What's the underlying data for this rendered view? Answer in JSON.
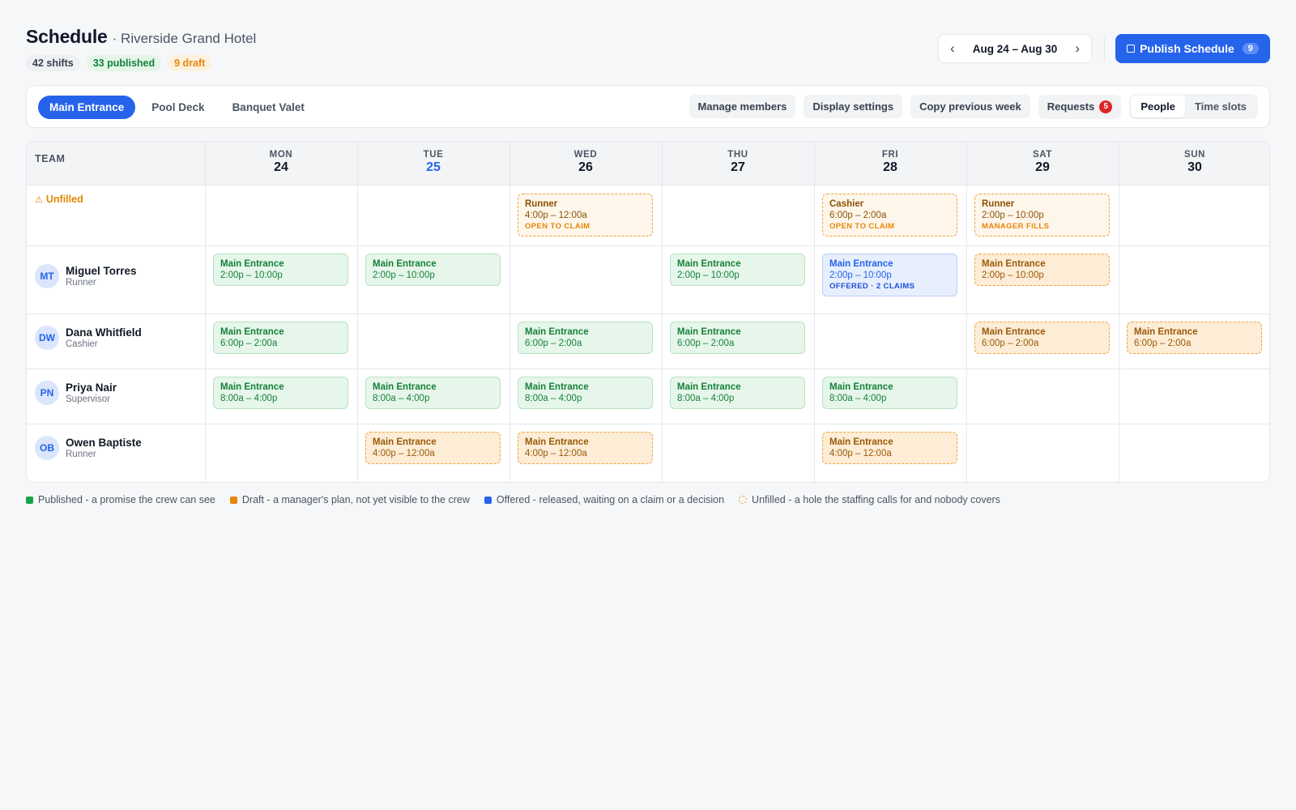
{
  "header": {
    "title": "Schedule",
    "subtitle": "· Riverside Grand Hotel",
    "stats": {
      "shifts": "42 shifts",
      "published": "33 published",
      "draft": "9 draft"
    },
    "week_range": "Aug 24 – Aug 30",
    "prev_arrow": "‹",
    "next_arrow": "›",
    "publish_label": "Publish Schedule",
    "publish_count": "9"
  },
  "toolbar": {
    "tabs": [
      {
        "label": "Main Entrance",
        "active": true
      },
      {
        "label": "Pool Deck",
        "active": false
      },
      {
        "label": "Banquet Valet",
        "active": false
      }
    ],
    "actions": {
      "manage_members": "Manage members",
      "display_settings": "Display settings",
      "copy_previous_week": "Copy previous week",
      "requests": "Requests",
      "requests_count": "5"
    },
    "view_toggle": {
      "people": "People",
      "time_slots": "Time slots",
      "active": "People"
    }
  },
  "grid": {
    "team_header": "TEAM",
    "days": [
      {
        "dow": "MON",
        "num": "24"
      },
      {
        "dow": "TUE",
        "num": "25",
        "today": true
      },
      {
        "dow": "WED",
        "num": "26"
      },
      {
        "dow": "THU",
        "num": "27"
      },
      {
        "dow": "FRI",
        "num": "28"
      },
      {
        "dow": "SAT",
        "num": "29"
      },
      {
        "dow": "SUN",
        "num": "30"
      }
    ],
    "unfilled_label": "Unfilled",
    "unfilled_shifts": [
      {
        "day": 2,
        "role": "Runner",
        "time": "4:00p – 12:00a",
        "note": "OPEN TO CLAIM"
      },
      {
        "day": 4,
        "role": "Cashier",
        "time": "6:00p – 2:00a",
        "note": "OPEN TO CLAIM"
      },
      {
        "day": 5,
        "role": "Runner",
        "time": "2:00p – 10:00p",
        "note": "MANAGER FILLS"
      }
    ],
    "people": [
      {
        "initials": "MT",
        "name": "Miguel Torres",
        "role": "Runner",
        "shifts": [
          {
            "day": 0,
            "state": "published",
            "name": "Main Entrance",
            "time": "2:00p – 10:00p"
          },
          {
            "day": 1,
            "state": "published",
            "name": "Main Entrance",
            "time": "2:00p – 10:00p"
          },
          {
            "day": 3,
            "state": "published",
            "name": "Main Entrance",
            "time": "2:00p – 10:00p"
          },
          {
            "day": 4,
            "state": "offered",
            "name": "Main Entrance",
            "time": "2:00p – 10:00p",
            "note": "OFFERED · 2 CLAIMS"
          },
          {
            "day": 5,
            "state": "draft",
            "name": "Main Entrance",
            "time": "2:00p – 10:00p"
          }
        ]
      },
      {
        "initials": "DW",
        "name": "Dana Whitfield",
        "role": "Cashier",
        "shifts": [
          {
            "day": 0,
            "state": "published",
            "name": "Main Entrance",
            "time": "6:00p – 2:00a"
          },
          {
            "day": 2,
            "state": "published",
            "name": "Main Entrance",
            "time": "6:00p – 2:00a"
          },
          {
            "day": 3,
            "state": "published",
            "name": "Main Entrance",
            "time": "6:00p – 2:00a"
          },
          {
            "day": 5,
            "state": "draft",
            "name": "Main Entrance",
            "time": "6:00p – 2:00a"
          },
          {
            "day": 6,
            "state": "draft",
            "name": "Main Entrance",
            "time": "6:00p – 2:00a"
          }
        ]
      },
      {
        "initials": "PN",
        "name": "Priya Nair",
        "role": "Supervisor",
        "shifts": [
          {
            "day": 0,
            "state": "published",
            "name": "Main Entrance",
            "time": "8:00a – 4:00p"
          },
          {
            "day": 1,
            "state": "published",
            "name": "Main Entrance",
            "time": "8:00a – 4:00p"
          },
          {
            "day": 2,
            "state": "published",
            "name": "Main Entrance",
            "time": "8:00a – 4:00p"
          },
          {
            "day": 3,
            "state": "published",
            "name": "Main Entrance",
            "time": "8:00a – 4:00p"
          },
          {
            "day": 4,
            "state": "published",
            "name": "Main Entrance",
            "time": "8:00a – 4:00p"
          }
        ]
      },
      {
        "initials": "OB",
        "name": "Owen Baptiste",
        "role": "Runner",
        "shifts": [
          {
            "day": 1,
            "state": "draft",
            "name": "Main Entrance",
            "time": "4:00p – 12:00a"
          },
          {
            "day": 2,
            "state": "draft",
            "name": "Main Entrance",
            "time": "4:00p – 12:00a"
          },
          {
            "day": 4,
            "state": "draft",
            "name": "Main Entrance",
            "time": "4:00p – 12:00a"
          }
        ]
      }
    ]
  },
  "legend": [
    {
      "key": "published",
      "label": "Published - a promise the crew can see",
      "color": "#16a34a"
    },
    {
      "key": "draft",
      "label": "Draft - a manager's plan, not yet visible to the crew",
      "color": "#e6870a"
    },
    {
      "key": "offered",
      "label": "Offered - released, waiting on a claim or a decision",
      "color": "#2563eb"
    },
    {
      "key": "unfilled",
      "label": "Unfilled - a hole the staffing calls for and nobody covers",
      "color": "#f0a340"
    }
  ],
  "colors": {
    "accent": "#2563eb",
    "published": "#16803a",
    "draft": "#e6870a",
    "alert": "#dc2626"
  }
}
